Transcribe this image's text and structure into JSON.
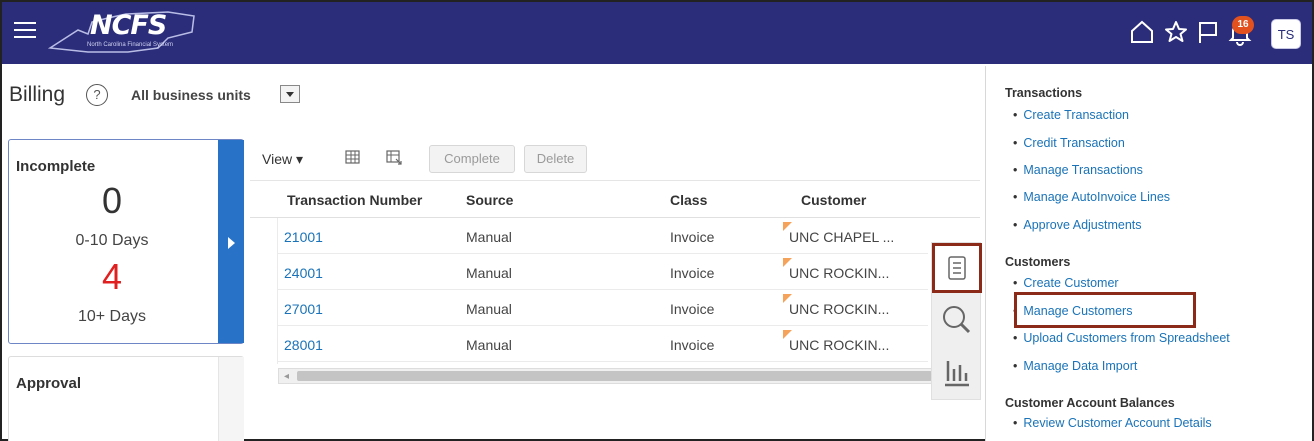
{
  "header": {
    "menu_icon": "hamburger-icon",
    "logo_text": "NCFS",
    "logo_sub": "North Carolina Financial System",
    "icons": [
      "home-icon",
      "star-icon",
      "flag-icon",
      "bell-icon"
    ],
    "notification_count": "16",
    "avatar_initials": "TS"
  },
  "page": {
    "title": "Billing",
    "help_icon": "help-icon",
    "business_unit_label": "All business units"
  },
  "tiles": {
    "incomplete": {
      "title": "Incomplete",
      "count_recent": "0",
      "label_recent": "0-10 Days",
      "count_old": "4",
      "label_old": "10+ Days"
    },
    "approval": {
      "title": "Approval"
    }
  },
  "toolbar": {
    "view_label": "View ▾",
    "complete_label": "Complete",
    "delete_label": "Delete"
  },
  "table": {
    "columns": [
      "Transaction Number",
      "Source",
      "Class",
      "Customer"
    ],
    "rows": [
      {
        "number": "21001",
        "source": "Manual",
        "class": "Invoice",
        "customer": "UNC CHAPEL ..."
      },
      {
        "number": "24001",
        "source": "Manual",
        "class": "Invoice",
        "customer": "UNC ROCKIN..."
      },
      {
        "number": "27001",
        "source": "Manual",
        "class": "Invoice",
        "customer": "UNC ROCKIN..."
      },
      {
        "number": "28001",
        "source": "Manual",
        "class": "Invoice",
        "customer": "UNC ROCKIN..."
      }
    ]
  },
  "side_tools": [
    "tasks-icon",
    "search-icon",
    "analytics-icon"
  ],
  "right_panel": {
    "sections": [
      {
        "heading": "Transactions",
        "links": [
          "Create Transaction",
          "Credit Transaction",
          "Manage Transactions",
          "Manage AutoInvoice Lines",
          "Approve Adjustments"
        ]
      },
      {
        "heading": "Customers",
        "links": [
          "Create Customer",
          "Manage Customers",
          "Upload Customers from Spreadsheet",
          "Manage Data Import"
        ]
      },
      {
        "heading": "Customer Account Balances",
        "links": [
          "Review Customer Account Details"
        ]
      }
    ]
  },
  "colors": {
    "header_bg": "#2b2d7a",
    "link": "#1a73b8",
    "tile_accent": "#2872c8",
    "highlight_box": "#8c2a1a",
    "overdue_count": "#e02020"
  }
}
